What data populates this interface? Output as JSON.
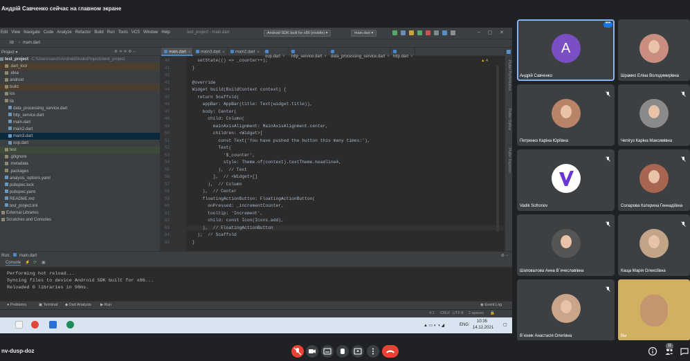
{
  "banner": "Андрій Савченко сейчас на главном экране",
  "ide": {
    "menu": [
      "Edit",
      "View",
      "Navigate",
      "Code",
      "Analyze",
      "Refactor",
      "Build",
      "Run",
      "Tools",
      "VCS",
      "Window",
      "Help"
    ],
    "window_title": "test_project - main.dart",
    "device": "Android SDK built for x86 (mobile)",
    "run_config": "main.dart",
    "breadcrumb": [
      "lib",
      "main.dart"
    ],
    "project_label": "Project",
    "project_root": "test_project",
    "project_path": "C:\\Users\\savch\\AndroidStudioProjects\\test_project",
    "tree": [
      {
        "label": ".dart_tool",
        "style": "brown",
        "indent": 1
      },
      {
        "label": ".idea",
        "style": "",
        "indent": 1
      },
      {
        "label": "android",
        "style": "",
        "indent": 1
      },
      {
        "label": "build",
        "style": "brown",
        "indent": 1
      },
      {
        "label": "ios",
        "style": "",
        "indent": 1
      },
      {
        "label": "lib",
        "style": "",
        "indent": 1
      },
      {
        "label": "data_processing_service.dart",
        "style": "",
        "indent": 2
      },
      {
        "label": "http_service.dart",
        "style": "",
        "indent": 2
      },
      {
        "label": "main.dart",
        "style": "",
        "indent": 2
      },
      {
        "label": "main2.dart",
        "style": "",
        "indent": 2
      },
      {
        "label": "main3.dart",
        "style": "sel",
        "indent": 2
      },
      {
        "label": "oop.dart",
        "style": "",
        "indent": 2
      },
      {
        "label": "test",
        "style": "green",
        "indent": 1
      },
      {
        "label": ".gitignore",
        "style": "",
        "indent": 1
      },
      {
        "label": ".metadata",
        "style": "",
        "indent": 1
      },
      {
        "label": ".packages",
        "style": "",
        "indent": 1
      },
      {
        "label": "analysis_options.yaml",
        "style": "",
        "indent": 1
      },
      {
        "label": "pubspec.lock",
        "style": "",
        "indent": 1
      },
      {
        "label": "pubspec.yaml",
        "style": "",
        "indent": 1
      },
      {
        "label": "README.md",
        "style": "",
        "indent": 1
      },
      {
        "label": "test_project.iml",
        "style": "",
        "indent": 1
      },
      {
        "label": "External Libraries",
        "style": "",
        "indent": 0
      },
      {
        "label": "Scratches and Consoles",
        "style": "",
        "indent": 0
      }
    ],
    "tabs": [
      "main.dart",
      "main3.dart",
      "main2.dart",
      "oop.dart",
      "http_service.dart",
      "data_processing_service.dart",
      "http.dart"
    ],
    "warnings": "▲ 4",
    "code_lines": [
      {
        "n": "40",
        "t": "    setState(() => _counter++);"
      },
      {
        "n": "41",
        "t": "  }"
      },
      {
        "n": "42",
        "t": ""
      },
      {
        "n": "43",
        "t": "  @override"
      },
      {
        "n": "44",
        "t": "  Widget build(BuildContext context) {"
      },
      {
        "n": "45",
        "t": "    return Scaffold("
      },
      {
        "n": "46",
        "t": "      appBar: AppBar(title: Text(widget.title)),"
      },
      {
        "n": "47",
        "t": "      body: Center("
      },
      {
        "n": "48",
        "t": "        child: Column("
      },
      {
        "n": "49",
        "t": "          mainAxisAlignment: MainAxisAlignment.center,"
      },
      {
        "n": "50",
        "t": "          children: <Widget>["
      },
      {
        "n": "51",
        "t": "            const Text('You have pushed the button this many times:'),"
      },
      {
        "n": "52",
        "t": "            Text("
      },
      {
        "n": "53",
        "t": "              '$_counter',"
      },
      {
        "n": "54",
        "t": "              style: Theme.of(context).textTheme.headline4,"
      },
      {
        "n": "55",
        "t": "            ),  // Text"
      },
      {
        "n": "56",
        "t": "          ],  // <Widget>[]"
      },
      {
        "n": "57",
        "t": "        ),  // Column"
      },
      {
        "n": "58",
        "t": "      ),  // Center"
      },
      {
        "n": "59",
        "t": "      floatingActionButton: FloatingActionButton("
      },
      {
        "n": "60",
        "t": "        onPressed: _incrementCounter,"
      },
      {
        "n": "61",
        "t": "        tooltip: 'Increment',"
      },
      {
        "n": "62",
        "t": "        child: const Icon(Icons.add),"
      },
      {
        "n": "63",
        "t": "      ),  // FloatingActionButton"
      },
      {
        "n": "64",
        "t": "    );  // Scaffold"
      },
      {
        "n": "65",
        "t": "  }"
      }
    ],
    "side_labels": [
      "Flutter Performance",
      "Flutter Outline",
      "Flutter Inspector"
    ],
    "run_tab": "main.dart",
    "console_tab": "Console",
    "console": [
      "Performing hot reload...",
      "Syncing files to device Android SDK built for x86...",
      "Reloaded 0 libraries in 98ms."
    ],
    "tool_windows": [
      "Problems",
      "Terminal",
      "Dart Analysis",
      "Run"
    ],
    "event_log": "Event Log",
    "status": {
      "pos": "4:1",
      "eol": "CRLF",
      "enc": "UTF-8",
      "indent": "2 spaces"
    }
  },
  "taskbar": {
    "lang": "ENG",
    "time": "10:35",
    "date": "14.12.2021"
  },
  "participants": [
    {
      "name": "Андрій Савченко",
      "avatar": "A",
      "type": "letter",
      "color": "#7b4fc4"
    },
    {
      "name": "Шрамко Еліна Володимирівна",
      "type": "photo",
      "color": "#c98e7f"
    },
    {
      "name": "Петренко Каріна Юріївна",
      "type": "photo",
      "color": "#b88468"
    },
    {
      "name": "Чепігуз Каріна Максимівна",
      "type": "photo",
      "color": "#8a8a8a"
    },
    {
      "name": "Vadik Sofronov",
      "type": "logo",
      "color": "#6a35d6"
    },
    {
      "name": "Соларова Катерина Геннадіївна",
      "type": "photo",
      "color": "#a8654f"
    },
    {
      "name": "Шаповалова Анна В`ячеславівна",
      "type": "photo",
      "color": "#555555"
    },
    {
      "name": "Каща Марія Олексіївна",
      "type": "photo",
      "color": "#c4a487"
    },
    {
      "name": "В`юник Анастасія Олегівна",
      "type": "photo",
      "color": "#caa58a"
    },
    {
      "name": "Вы",
      "type": "video",
      "color": "#d1b062"
    }
  ],
  "meeting_code": "nv-dusp-doz",
  "participant_count": "11"
}
